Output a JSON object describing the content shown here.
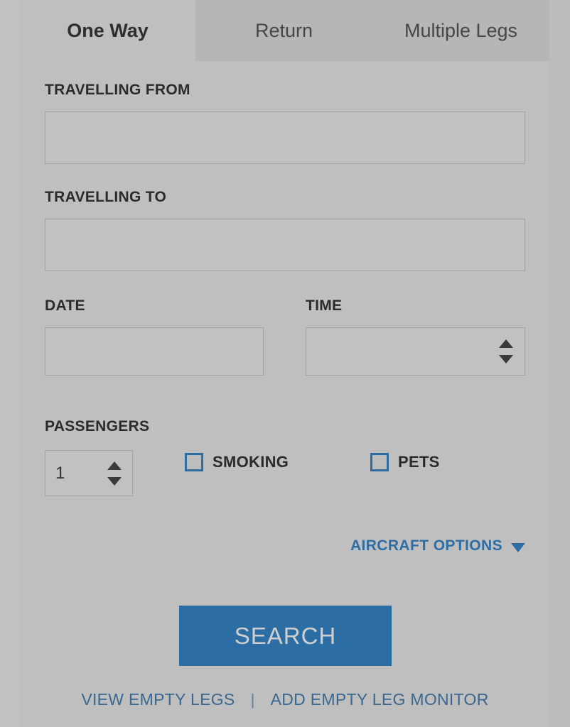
{
  "tabs": [
    {
      "id": "one-way",
      "label": "One Way",
      "active": true
    },
    {
      "id": "return",
      "label": "Return",
      "active": false
    },
    {
      "id": "multiple-legs",
      "label": "Multiple Legs",
      "active": false
    }
  ],
  "form": {
    "travelling_from": {
      "label": "TRAVELLING FROM",
      "value": "",
      "placeholder": ""
    },
    "travelling_to": {
      "label": "TRAVELLING TO",
      "value": "",
      "placeholder": ""
    },
    "date": {
      "label": "DATE",
      "value": "",
      "placeholder": ""
    },
    "time": {
      "label": "TIME",
      "value": "",
      "placeholder": ""
    },
    "passengers": {
      "label": "PASSENGERS",
      "value": "1"
    },
    "smoking": {
      "label": "SMOKING",
      "checked": false
    },
    "pets": {
      "label": "PETS",
      "checked": false
    }
  },
  "aircraft_options": {
    "label": "AIRCRAFT OPTIONS",
    "caret_icon": "chevron-down-icon"
  },
  "search": {
    "label": "SEARCH"
  },
  "footer": {
    "view_empty_legs": "VIEW EMPTY LEGS",
    "separator": "|",
    "add_empty_leg_monitor": "ADD EMPTY LEG MONITOR"
  },
  "icons": {
    "spinner_up": "triangle-up-icon",
    "spinner_down": "triangle-down-icon"
  },
  "colors": {
    "background": "#bfbfbf",
    "accent_blue": "#2c6da3",
    "link_blue": "#3a6790",
    "tab_active_bg": "#b6b6b6",
    "text_dark": "#2b2b2b",
    "input_border": "#a3a3a3"
  }
}
